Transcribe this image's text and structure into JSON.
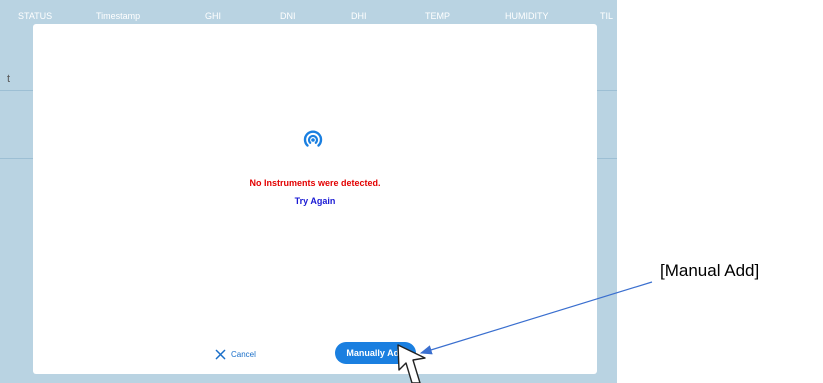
{
  "table_header": {
    "columns": [
      "STATUS",
      "Timestamp",
      "GHI",
      "DNI",
      "DHI",
      "TEMP",
      "HUMIDITY",
      "TIL"
    ]
  },
  "background": {
    "partial_text": "t"
  },
  "dialog": {
    "error_message": "No Instruments were detected.",
    "retry_label": "Try Again",
    "cancel_label": "Cancel",
    "manual_add_label": "Manually Add",
    "icons": {
      "status": "wireless-signal-icon",
      "cancel": "close-icon"
    }
  },
  "annotation": {
    "label": "[Manual Add]"
  },
  "colors": {
    "error": "#e30000",
    "link": "#1a1ad4",
    "primary_button": "#1a7fe0",
    "backdrop": "#b9d3e2"
  }
}
